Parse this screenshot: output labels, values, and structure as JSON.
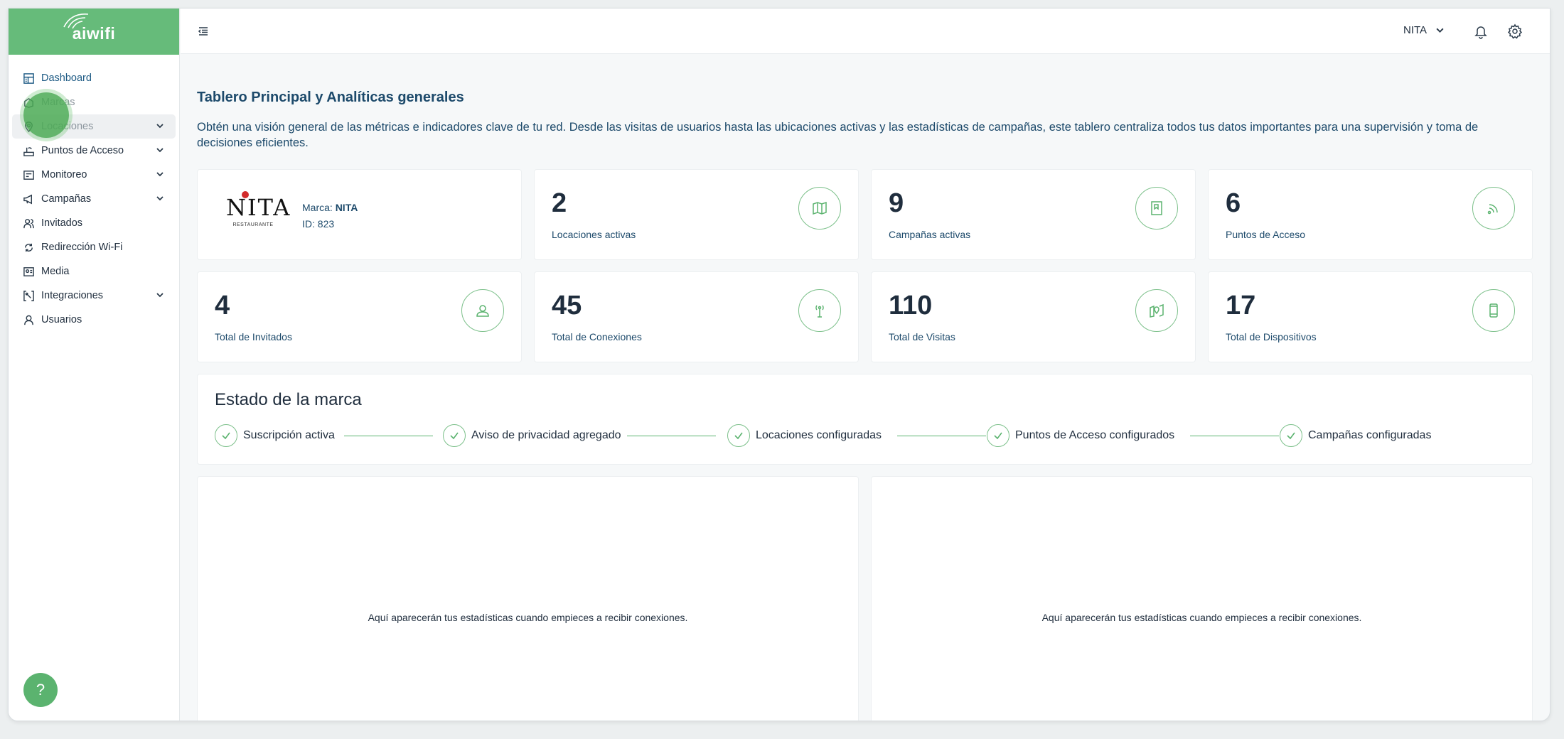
{
  "logo": {
    "text": "aiwifi"
  },
  "sidebar": {
    "items": [
      {
        "label": "Dashboard",
        "icon": "dashboard-icon",
        "expandable": false
      },
      {
        "label": "Marcas",
        "icon": "brands-icon",
        "expandable": false
      },
      {
        "label": "Locaciones",
        "icon": "location-pin-icon",
        "expandable": true
      },
      {
        "label": "Puntos de Acceso",
        "icon": "router-icon",
        "expandable": true
      },
      {
        "label": "Monitoreo",
        "icon": "monitor-icon",
        "expandable": true
      },
      {
        "label": "Campañas",
        "icon": "megaphone-icon",
        "expandable": true
      },
      {
        "label": "Invitados",
        "icon": "guests-icon",
        "expandable": false
      },
      {
        "label": "Redirección Wi-Fi",
        "icon": "redirect-icon",
        "expandable": false
      },
      {
        "label": "Media",
        "icon": "media-icon",
        "expandable": false
      },
      {
        "label": "Integraciones",
        "icon": "integrations-icon",
        "expandable": true
      },
      {
        "label": "Usuarios",
        "icon": "user-icon",
        "expandable": false
      }
    ]
  },
  "help": {
    "label": "?"
  },
  "topbar": {
    "brand_selected": "NITA"
  },
  "page": {
    "title": "Tablero Principal y Analíticas generales",
    "description": "Obtén una visión general de las métricas e indicadores clave de tu red. Desde las visitas de usuarios hasta las ubicaciones activas y las estadísticas de campañas, este tablero centraliza todos tus datos importantes para una supervisión y toma de decisiones eficientes."
  },
  "brand_card": {
    "logo_word": "NITA",
    "logo_sub": "RESTAURANTE",
    "brand_prefix": "Marca: ",
    "brand_name": "NITA",
    "id_text": "ID: 823"
  },
  "stats": [
    {
      "value": "2",
      "label": "Locaciones activas",
      "icon": "map-icon"
    },
    {
      "value": "9",
      "label": "Campañas activas",
      "icon": "campaign-book-icon"
    },
    {
      "value": "6",
      "label": "Puntos de Acceso",
      "icon": "wifi-signal-icon"
    },
    {
      "value": "4",
      "label": "Total de Invitados",
      "icon": "guest-icon"
    },
    {
      "value": "45",
      "label": "Total de Conexiones",
      "icon": "antenna-icon"
    },
    {
      "value": "110",
      "label": "Total de Visitas",
      "icon": "map-pin-icon"
    },
    {
      "value": "17",
      "label": "Total de Dispositivos",
      "icon": "mobile-device-icon"
    }
  ],
  "status": {
    "title": "Estado de la marca",
    "steps": [
      "Suscripción activa",
      "Aviso de privacidad agregado",
      "Locaciones configuradas",
      "Puntos de Acceso configurados",
      "Campañas configuradas"
    ]
  },
  "charts": {
    "empty_left": "Aquí aparecerán tus estadísticas cuando empieces a recibir conexiones.",
    "empty_right": "Aquí aparecerán tus estadísticas cuando empieces a recibir conexiones."
  },
  "colors": {
    "accent": "#5bb36f",
    "logo_bg": "#66bb7a",
    "title": "#1d4a6b"
  }
}
